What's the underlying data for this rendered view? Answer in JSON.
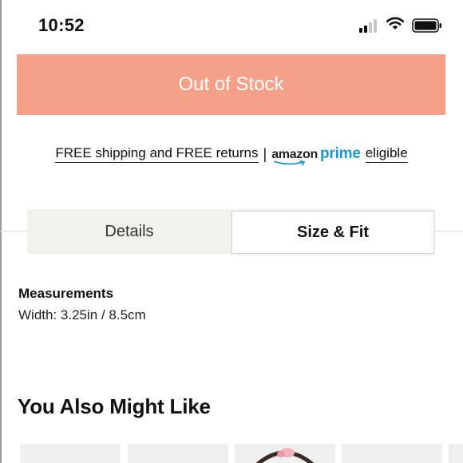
{
  "status_bar": {
    "time": "10:52",
    "signal_icon": "cellular-signal-icon",
    "wifi_icon": "wifi-icon",
    "battery_icon": "battery-icon"
  },
  "product": {
    "stock_button_label": "Out of Stock",
    "stock_button_color": "#f5a088"
  },
  "shipping": {
    "text": "FREE shipping and FREE returns",
    "separator": "|",
    "amazon_label": "amazon",
    "prime_label": "prime",
    "eligible_label": "eligible",
    "prime_color": "#1a98c9"
  },
  "tabs": [
    {
      "label": "Details",
      "active": false
    },
    {
      "label": "Size & Fit",
      "active": true
    }
  ],
  "measurements": {
    "title": "Measurements",
    "value": "Width: 3.25in / 8.5cm"
  },
  "recommendations": {
    "title": "You Also Might Like"
  }
}
